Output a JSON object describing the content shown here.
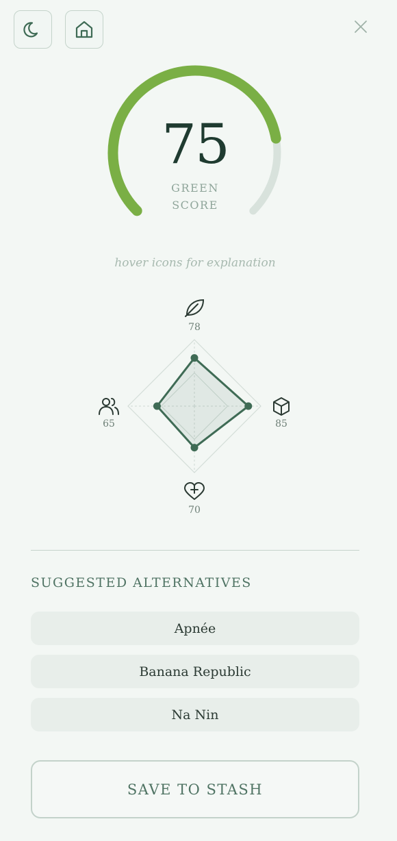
{
  "header": {
    "theme_icon": "moon-icon",
    "home_icon": "home-icon",
    "close_icon": "close-icon"
  },
  "score": {
    "value": "75",
    "fraction": 0.75,
    "label_line1": "GREEN",
    "label_line2": "SCORE",
    "arc_color": "#7aaf45",
    "track_color": "#d8e2dc"
  },
  "hint": "hover icons for explanation",
  "radar": {
    "axes": [
      {
        "icon": "leaf-icon",
        "value": 78
      },
      {
        "icon": "cube-icon",
        "value": 85
      },
      {
        "icon": "heart-plus-icon",
        "value": 70
      },
      {
        "icon": "people-icon",
        "value": 65
      }
    ],
    "color": "#3f6b55"
  },
  "alternatives": {
    "title": "SUGGESTED ALTERNATIVES",
    "items": [
      "Apnée",
      "Banana Republic",
      "Na Nin"
    ]
  },
  "save_label": "SAVE TO STASH"
}
